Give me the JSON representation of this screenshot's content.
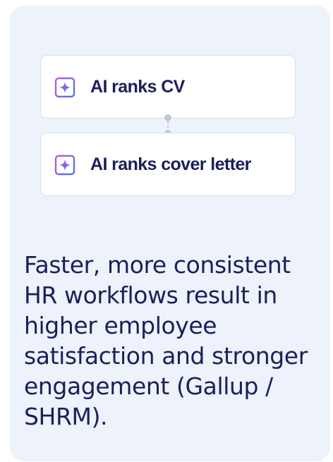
{
  "steps": [
    {
      "label": "AI ranks CV",
      "icon": "ai-sparkle-icon"
    },
    {
      "label": "AI ranks cover letter",
      "icon": "ai-sparkle-icon"
    }
  ],
  "description": "Faster, more consistent HR workflows result in higher employee satisfaction and stronger engagement (Gallup / SHRM).",
  "colors": {
    "card_background": "#edf2fb",
    "step_background": "#ffffff",
    "step_border": "#d9e0ec",
    "text_dark": "#1c1f59",
    "connector": "#c2c8d6",
    "icon_gradient_start": "#c35bd6",
    "icon_gradient_end": "#4b74ef"
  }
}
